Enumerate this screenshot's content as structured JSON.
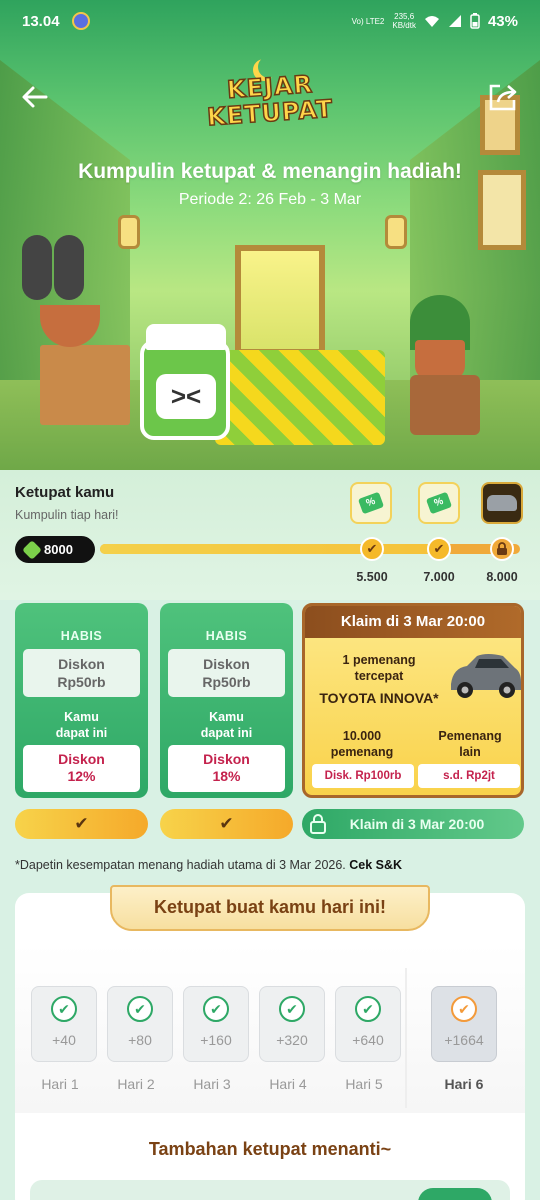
{
  "status_bar": {
    "time": "13.04",
    "network": "Vo) LTE2",
    "speed_value": "235,6",
    "speed_unit": "KB/dtk",
    "battery": "43%"
  },
  "hero": {
    "logo_line1": "KEJAR",
    "logo_line2": "KETUPAT",
    "title": "Kumpulin ketupat & menangin hadiah!",
    "period": "Periode 2: 26 Feb - 3 Mar",
    "icons": {
      "back": "back-arrow-icon",
      "share": "share-icon"
    }
  },
  "progress": {
    "title": "Ketupat kamu",
    "subtitle": "Kumpulin tiap hari!",
    "count": "8000",
    "fill_fraction": 0.8,
    "milestones": [
      {
        "label": "5.500",
        "state": "claimed",
        "reward_icon": "voucher-icon"
      },
      {
        "label": "7.000",
        "state": "claimed",
        "reward_icon": "voucher-icon"
      },
      {
        "label": "8.000",
        "state": "locked",
        "reward_icon": "car-icon"
      }
    ]
  },
  "cards": [
    {
      "status": "HABIS",
      "ticket_top": "Diskon\nRp50rb",
      "you_got": "Kamu\ndapat ini",
      "ticket_bottom": "Diskon\n12%"
    },
    {
      "status": "HABIS",
      "ticket_top": "Diskon\nRp50rb",
      "you_got": "Kamu\ndapat ini",
      "ticket_bottom": "Diskon\n18%"
    }
  ],
  "grand": {
    "header": "Klaim di 3 Mar 20:00",
    "winner1": "1 pemenang\ntercepat",
    "car": "TOYOTA INNOVA*",
    "group1_title": "10.000\npemenang",
    "group1_prize": "Disk. Rp100rb",
    "group2_title": "Pemenang\nlain",
    "group2_prize": "s.d. Rp2jt",
    "claim_button": "Klaim di 3 Mar 20:00"
  },
  "note": {
    "text": "*Dapetin kesempatan menang hadiah utama di 3 Mar 2026. ",
    "link": "Cek S&K"
  },
  "daily": {
    "title": "Ketupat buat kamu hari ini!",
    "days": [
      {
        "points": "+40",
        "label": "Hari 1",
        "today": false
      },
      {
        "points": "+80",
        "label": "Hari 2",
        "today": false
      },
      {
        "points": "+160",
        "label": "Hari 3",
        "today": false
      },
      {
        "points": "+320",
        "label": "Hari 4",
        "today": false
      },
      {
        "points": "+640",
        "label": "Hari 5",
        "today": false
      },
      {
        "points": "+1664",
        "label": "Hari 6",
        "today": true
      }
    ],
    "more_title": "Tambahan ketupat menanti~"
  },
  "colors": {
    "primary_green": "#2ea866",
    "accent_yellow": "#f5c23a",
    "brown": "#7a4214",
    "discount_red": "#c4224d"
  }
}
